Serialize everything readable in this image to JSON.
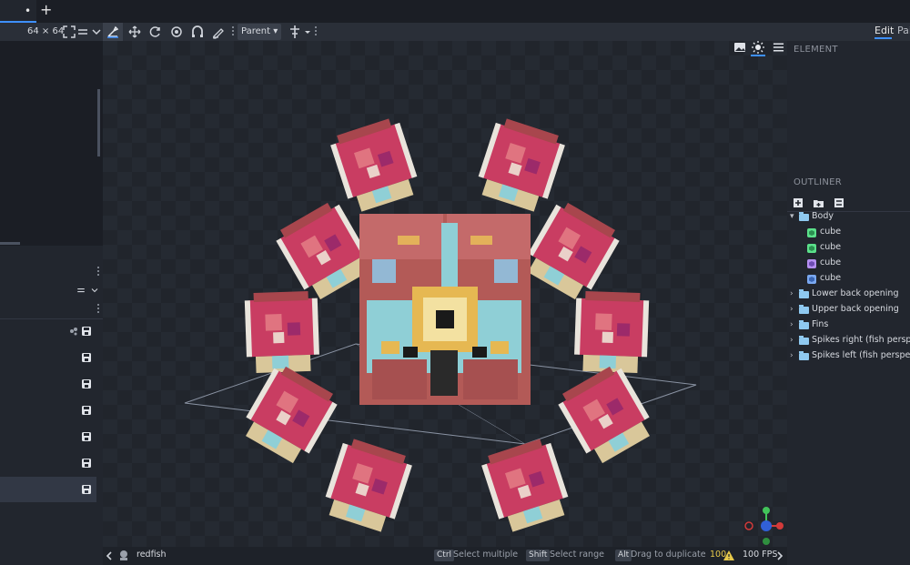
{
  "tabs": {
    "active_marker": "•",
    "add_label": "+"
  },
  "toolbar": {
    "resolution": "64 × 64",
    "transform_space": "Parent",
    "mode_tabs": {
      "edit": "Edit",
      "paint": "Pai"
    }
  },
  "right_panel": {
    "element_title": "ELEMENT",
    "outliner_title": "OUTLINER",
    "outliner": [
      {
        "type": "group",
        "label": "Body",
        "expanded": true
      },
      {
        "type": "cube",
        "label": "cube",
        "color": "#5be08a"
      },
      {
        "type": "cube",
        "label": "cube",
        "color": "#5be08a"
      },
      {
        "type": "cube",
        "label": "cube",
        "color": "#b58ff0"
      },
      {
        "type": "cube",
        "label": "cube",
        "color": "#7aa8f0"
      },
      {
        "type": "group",
        "label": "Lower back opening",
        "expanded": false
      },
      {
        "type": "group",
        "label": "Upper back opening",
        "expanded": false
      },
      {
        "type": "group",
        "label": "Fins",
        "expanded": false
      },
      {
        "type": "group",
        "label": "Spikes right (fish perspective)",
        "expanded": false
      },
      {
        "type": "group",
        "label": "Spikes left (fish perspective)",
        "expanded": false
      }
    ]
  },
  "statusbar": {
    "model_name": "redfish",
    "hints": [
      {
        "key": "Ctrl",
        "text": "Select multiple"
      },
      {
        "key": "Shift",
        "text": "Select range"
      },
      {
        "key": "Alt",
        "text": "Drag to duplicate"
      }
    ],
    "warnings": "100",
    "fps": "100 FPS"
  },
  "colors": {
    "accent": "#3e90ff",
    "fish_pink": "#c93d62",
    "fish_body": "#b35a57",
    "fish_cyan": "#8fcfd6"
  }
}
